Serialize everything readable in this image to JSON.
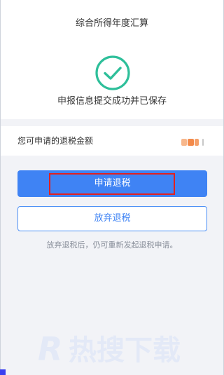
{
  "header": {
    "title": "综合所得年度汇算"
  },
  "success": {
    "icon": "check-circle-icon",
    "message": "申报信息提交成功并已保存",
    "accent_color": "#2ebf9a"
  },
  "amount": {
    "label": "您可申请的退税金额"
  },
  "actions": {
    "apply_label": "申请退税",
    "abandon_label": "放弃退税",
    "hint": "放弃退税后，仍可重新发起退税申请。",
    "primary_color": "#3f83f4",
    "highlight_color": "#e2201f"
  },
  "watermark": {
    "text": "R热搜下载"
  }
}
